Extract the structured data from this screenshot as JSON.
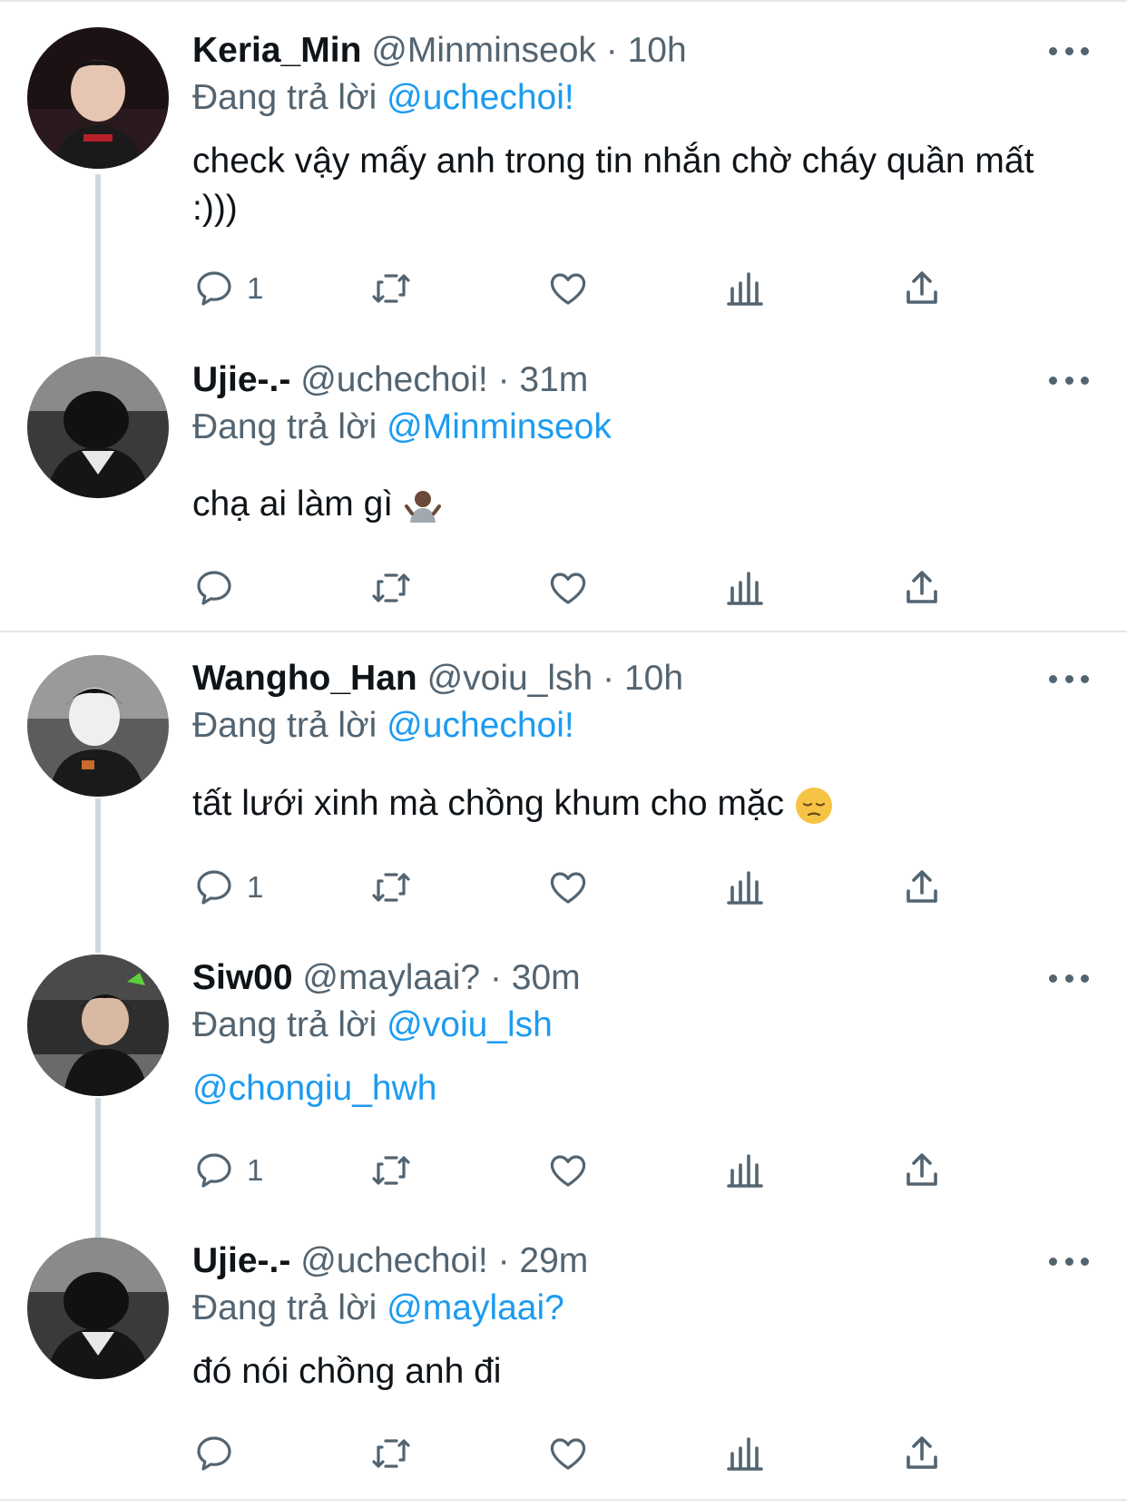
{
  "reply_prefix": "Đang trả lời",
  "tweets": [
    {
      "name": "Keria_Min",
      "handle": "@Minminseok",
      "time": "10h",
      "reply_to": "@uchechoi!",
      "text": "check vậy mấy anh trong tin nhắn chờ cháy quần mất :)))",
      "reply_count": "1",
      "avatar": "avatar-keria"
    },
    {
      "name": "Ujie-.-",
      "handle": "@uchechoi!",
      "time": "31m",
      "reply_to": "@Minminseok",
      "text": "chạ ai làm gì",
      "emoji": "person-shrugging-emoji",
      "reply_count": "",
      "avatar": "avatar-ujie"
    },
    {
      "name": "Wangho_Han",
      "handle": "@voiu_lsh",
      "time": "10h",
      "reply_to": "@uchechoi!",
      "text": "tất lưới xinh mà chồng khum cho mặc",
      "emoji": "pensive-face-emoji",
      "reply_count": "1",
      "avatar": "avatar-wangho"
    },
    {
      "name": "Siw00",
      "handle": "@maylaai?",
      "time": "30m",
      "reply_to": "@voiu_lsh",
      "text": "@chongiu_hwh",
      "reply_count": "1",
      "avatar": "avatar-siw00"
    },
    {
      "name": "Ujie-.-",
      "handle": "@uchechoi!",
      "time": "29m",
      "reply_to": "@maylaai?",
      "text": "đó nói chồng anh đi",
      "reply_count": "",
      "avatar": "avatar-ujie"
    }
  ],
  "separator": "·",
  "colors": {
    "accent": "#1d9bf0",
    "muted": "#536471",
    "text": "#0f1419",
    "thread_line": "#cfd9de"
  }
}
